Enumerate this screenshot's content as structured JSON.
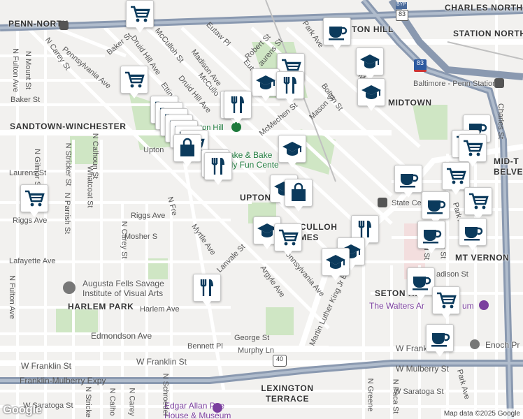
{
  "neighborhoods": {
    "penn_north": "PENN-NORTH",
    "charles_north": "CHARLES NORTH",
    "station_north": "STATION NORTH",
    "bolton_hill": "TON HILL",
    "midtown": "MIDTOWN",
    "mid_town_belvedere": "MID-T BELVE",
    "sandtown": "SANDTOWN-WINCHESTER",
    "upton_hood": "UPTON",
    "mcculloh_homes": "MCCULLOH HOMES",
    "mt_vernon": "MT VERNON",
    "seton_hill": "SETON HI",
    "harlem_park": "HARLEM PARK",
    "lexington_terrace": "LEXINGTON TERRACE"
  },
  "places": {
    "upton_hill": "Upton Hill",
    "penn_station": "Baltimore - Penn Station",
    "bake_bake": "Bake & Bake",
    "family_fun": "mily Fun Cente",
    "state_center": "State Ce",
    "augusta_fells": "Augusta Fells Savage",
    "augusta_fells_2": "Institute of Visual Arts",
    "walters": "The Walters Ar",
    "walters_end": "um",
    "enoch": "Enoch Pr",
    "edgar_poe": "Edgar Allan Poe",
    "edgar_poe_2": "House & Museum",
    "upton_station": "Upton"
  },
  "streets": {
    "baker_st_top": "Baker St",
    "pennsylvania_ave_nw": "Pennsylvania Ave",
    "n_carey_st_top": "N Carey St",
    "druid_hill_ave": "Druid Hill Ave",
    "mcculloh_st_top": "McCulloh St",
    "madison_ave_top": "Madison Ave",
    "eutaw_pl": "Eutaw Pl",
    "robert_st": "Robert St",
    "eutaw_top": "Eut",
    "laurens_top": "aurens St",
    "park_ave_top": "Park Ave",
    "n_fulton_ave_left": "N Fulton Ave",
    "n_mount_st": "N Mount St",
    "baker_st_left": "Baker St",
    "mcculloh_mid": "McCullo",
    "druid_hill_mid": "Druid Hill Ave",
    "etting": "Etting",
    "mcmechen": "McMechen St",
    "mason": "Mason St",
    "bolton": "Bolton St",
    "mosher_right": "Moshe",
    "n_gilmor": "N Gilmor St",
    "n_stricker": "N Stricker St",
    "n_calhoun": "N Calhoun St",
    "whatcoat": "Whatcoat St",
    "laurens_left": "Laurens St",
    "n_parrish": "N Parrish St",
    "riggs_left": "Riggs Ave",
    "riggs_mid": "Riggs Ave",
    "n_carey_mid": "N Carey St",
    "mosher_mid": "Mosher S",
    "myrtle": "Myrtle Ave",
    "n_fremont": "N Fre",
    "lafayette": "Lafayette Ave",
    "lanvale": "Lanvale St",
    "pennsylvania_se": "Pennsylvania Ave",
    "argyle": "Argyle Ave",
    "mlk": "Martin Luther King Jr Blvd",
    "harlem_ave": "Harlem Ave",
    "edmondson": "Edmondson Ave",
    "george": "George St",
    "bennett": "Bennett Pl",
    "murphy": "Murphy Ln",
    "w_franklin_left": "W Franklin St",
    "w_franklin_mid": "W Franklin St",
    "w_franklin_right": "W Frank",
    "franklin_mulberry": "Franklin-Mulberry Expy",
    "w_mulberry": "W Mulberry St",
    "w_saratoga_left": "W Saratoga St",
    "w_saratoga_right": "W Saratoga St",
    "n_fulton_bottom": "N Fulton Ave",
    "n_greene": "N Greene",
    "n_paca": "N Paca St",
    "park_ave_bottom": "Park Ave",
    "charles_st": "Charles St",
    "park_ave_right": "Park Ave",
    "n_howard": "rd St",
    "madison_right": "adison St",
    "n_eutaw_right": "on St",
    "n_calhoun_bottom": "N Calho",
    "n_carey_bottom": "N Carey",
    "n_stricker_bottom": "N Stricke",
    "n_schroeder": "N Schroeder"
  },
  "highways": {
    "i83_top": "83",
    "i83_mid": "83",
    "us40_badge": "40",
    "byp_badge": "BYP"
  },
  "attribution": "Map data ©2025 Google",
  "logo": "Google",
  "colors": {
    "grocery": "#0b3a5c",
    "cafe": "#0b3a5c",
    "school": "#0b3a5c",
    "restaurant": "#0b3a5c",
    "shopping": "#0b3a5c",
    "highway": "#7d8ca3",
    "arterial": "#ffffff",
    "park": "#cfe6c4",
    "transit_badge": "#555555"
  },
  "markers": [
    {
      "type": "grocery-cart",
      "icon": "cart-icon"
    },
    {
      "type": "cafe-cup",
      "icon": "coffee-cup-icon"
    },
    {
      "type": "school",
      "icon": "mortarboard-icon"
    },
    {
      "type": "restaurant",
      "icon": "fork-knife-icon"
    },
    {
      "type": "shopping-bag",
      "icon": "shopping-bag-icon"
    }
  ]
}
